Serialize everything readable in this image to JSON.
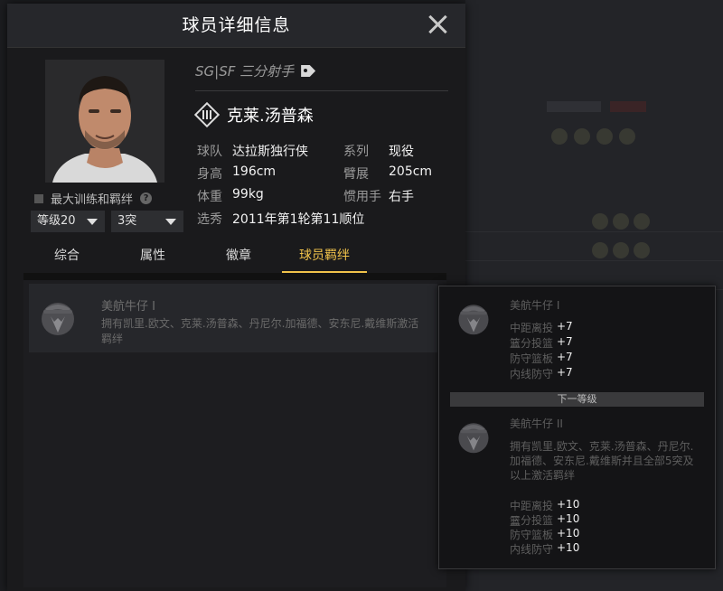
{
  "dialog": {
    "title": "球员详细信息",
    "close_label": ""
  },
  "player": {
    "position": "SG|SF 三分射手",
    "name": "克莱.汤普森",
    "max_training_label": "最大训练和羁绊",
    "level_select": "等级20",
    "breakthrough_select": "3突",
    "info": {
      "team_label": "球队",
      "team_value": "达拉斯独行侠",
      "series_label": "系列",
      "series_value": "现役",
      "height_label": "身高",
      "height_value": "196cm",
      "wingspan_label": "臂展",
      "wingspan_value": "205cm",
      "weight_label": "体重",
      "weight_value": "99kg",
      "hand_label": "惯用手",
      "hand_value": "右手",
      "draft_label": "选秀",
      "draft_value": "2011年第1轮第11顺位"
    }
  },
  "tabs": [
    {
      "label": "综合"
    },
    {
      "label": "属性"
    },
    {
      "label": "徽章"
    },
    {
      "label": "球员羁绊"
    }
  ],
  "bond": {
    "title": "美航牛仔 I",
    "description": "拥有凯里.欧文、克莱.汤普森、丹尼尔.加福德、安东尼.戴维斯激活羁绊"
  },
  "tooltip": {
    "current": {
      "title": "美航牛仔 I",
      "stats": [
        {
          "name": "中距离投篮",
          "value": "+7"
        },
        {
          "name": "三分投篮",
          "value": "+7"
        },
        {
          "name": "防守篮板",
          "value": "+7"
        },
        {
          "name": "内线防守",
          "value": "+7"
        }
      ]
    },
    "next_level_label": "下一等级",
    "next": {
      "title": "美航牛仔 II",
      "description": "拥有凯里.欧文、克莱.汤普森、丹尼尔.加福德、安东尼.戴维斯并且全部5突及以上激活羁绊",
      "stats": [
        {
          "name": "中距离投篮",
          "value": "+10"
        },
        {
          "name": "三分投篮",
          "value": "+10"
        },
        {
          "name": "防守篮板",
          "value": "+10"
        },
        {
          "name": "内线防守",
          "value": "+10"
        }
      ]
    }
  },
  "colors": {
    "accent": "#f0c24a",
    "panel": "#1a1a1c",
    "titlebar": "#26272b"
  }
}
